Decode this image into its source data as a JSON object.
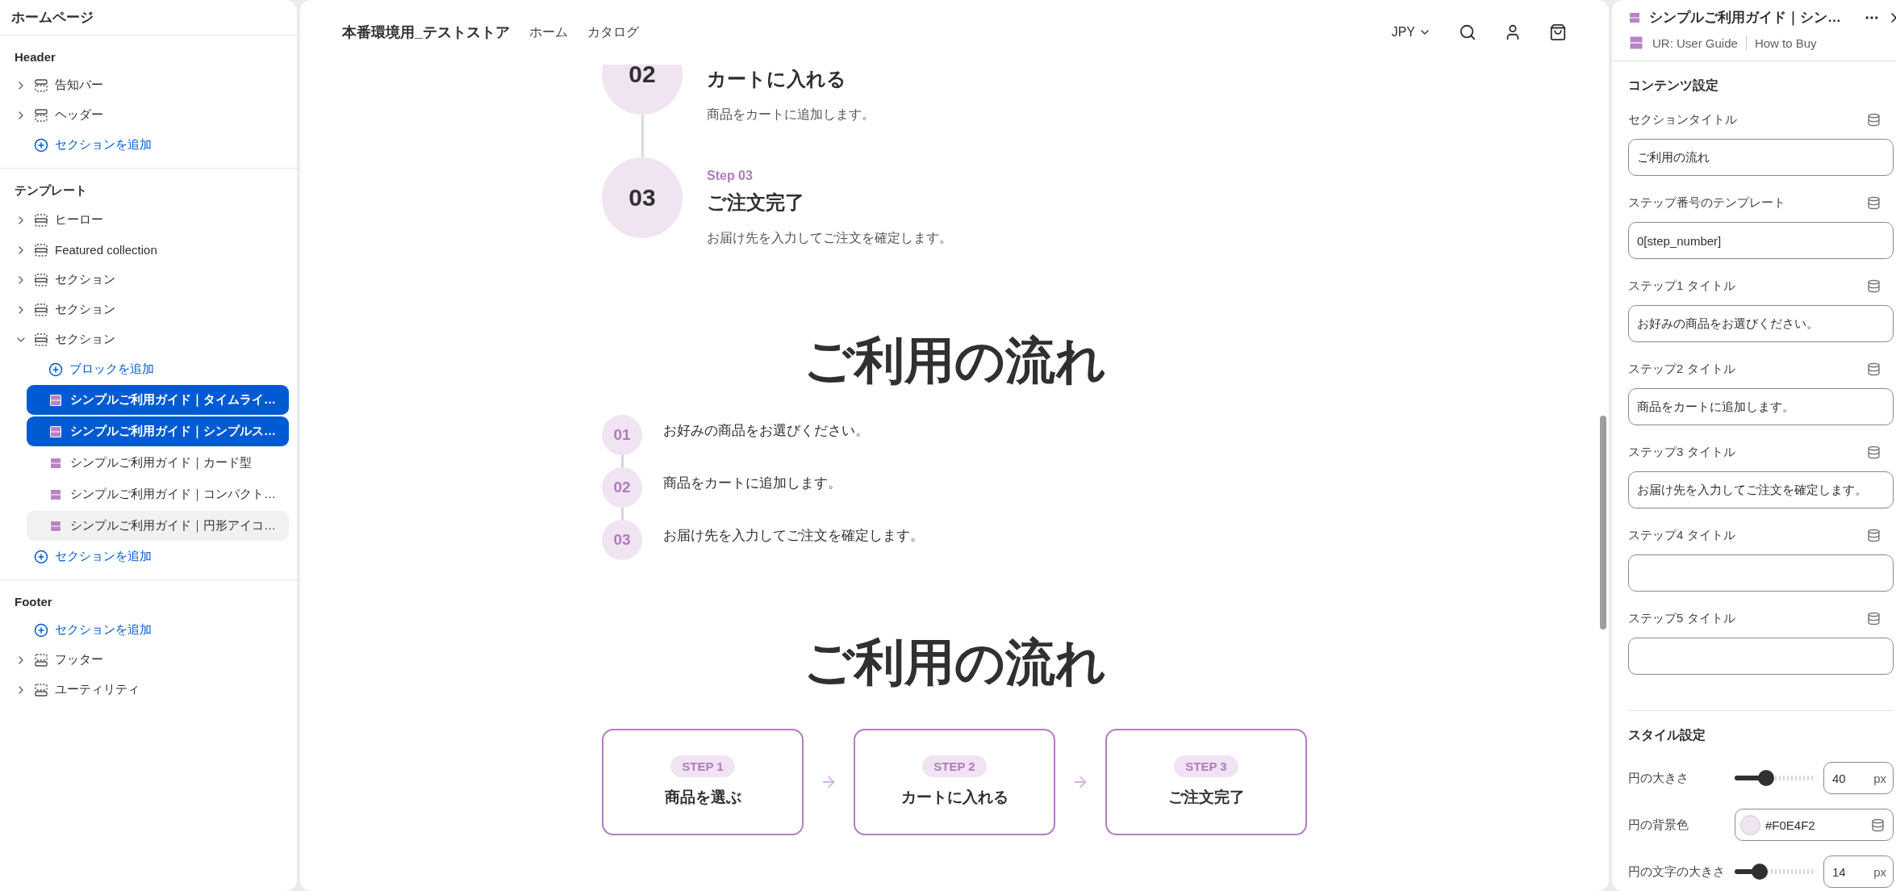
{
  "sidebar": {
    "title": "ホームページ",
    "groups": [
      {
        "kind": "header",
        "heading": "Header",
        "add_label": "セクションを追加",
        "items": [
          {
            "label": "告知バー",
            "expanded": false
          },
          {
            "label": "ヘッダー",
            "expanded": false
          }
        ]
      },
      {
        "kind": "template",
        "heading": "テンプレート",
        "add_label": "セクションを追加",
        "items": [
          {
            "label": "ヒーロー",
            "expanded": false
          },
          {
            "label": "Featured collection",
            "expanded": false
          },
          {
            "label": "セクション",
            "expanded": false
          },
          {
            "label": "セクション",
            "expanded": false
          },
          {
            "label": "セクション",
            "expanded": true,
            "add_block": "ブロックを追加",
            "children": [
              {
                "label": "シンプルご利用ガイド｜タイムライ…",
                "selected": true,
                "hovered": false
              },
              {
                "label": "シンプルご利用ガイド｜シンプルス…",
                "selected": true,
                "hovered": false
              },
              {
                "label": "シンプルご利用ガイド｜カード型",
                "selected": false,
                "hovered": false
              },
              {
                "label": "シンプルご利用ガイド｜コンパクト…",
                "selected": false,
                "hovered": false
              },
              {
                "label": "シンプルご利用ガイド｜円形アイコ…",
                "selected": false,
                "hovered": true
              }
            ]
          }
        ]
      },
      {
        "kind": "footer",
        "heading": "Footer",
        "add_label": "セクションを追加",
        "items": [
          {
            "label": "フッター",
            "expanded": false
          },
          {
            "label": "ユーティリティ",
            "expanded": false
          }
        ]
      }
    ]
  },
  "preview": {
    "store_name": "本番環境用_テストストア",
    "nav": [
      "ホーム",
      "カタログ"
    ],
    "currency": "JPY",
    "timeline": {
      "steps": [
        {
          "number": "02",
          "title": "カートに入れる",
          "description": "商品をカートに追加します。"
        },
        {
          "label": "Step 03",
          "number": "03",
          "title": "ご注文完了",
          "description": "お届け先を入力してご注文を確定します。"
        }
      ]
    },
    "compact": {
      "heading": "ご利用の流れ",
      "steps": [
        {
          "number": "01",
          "text": "お好みの商品をお選びください。"
        },
        {
          "number": "02",
          "text": "商品をカートに追加します。"
        },
        {
          "number": "03",
          "text": "お届け先を入力してご注文を確定します。"
        }
      ]
    },
    "cards": {
      "heading": "ご利用の流れ",
      "steps": [
        {
          "badge": "STEP 1",
          "title": "商品を選ぶ"
        },
        {
          "badge": "STEP 2",
          "title": "カートに入れる"
        },
        {
          "badge": "STEP 3",
          "title": "ご注文完了"
        }
      ]
    }
  },
  "panel": {
    "title": "シンプルご利用ガイド｜シン…",
    "breadcrumb": [
      "UR: User Guide",
      "How to Buy"
    ],
    "sections": [
      {
        "heading": "コンテンツ設定",
        "fields": [
          {
            "kind": "text",
            "label": "セクションタイトル",
            "value": "ご利用の流れ"
          },
          {
            "kind": "text",
            "label": "ステップ番号のテンプレート",
            "value": "0[step_number]"
          },
          {
            "kind": "text",
            "label": "ステップ1 タイトル",
            "value": "お好みの商品をお選びください。"
          },
          {
            "kind": "text",
            "label": "ステップ2 タイトル",
            "value": "商品をカートに追加します。"
          },
          {
            "kind": "text",
            "label": "ステップ3 タイトル",
            "value": "お届け先を入力してご注文を確定します。"
          },
          {
            "kind": "text",
            "label": "ステップ4 タイトル"
          },
          {
            "kind": "text",
            "label": "ステップ5 タイトル"
          }
        ]
      },
      {
        "heading": "スタイル設定",
        "fields": [
          {
            "kind": "slider",
            "label": "円の大きさ",
            "level": 0.39,
            "value": "40",
            "unit": "px"
          },
          {
            "kind": "color",
            "label": "円の背景色",
            "value": "#F0E4F2",
            "color": "#f0e4f2"
          },
          {
            "kind": "slider",
            "label": "円の文字の大きさ",
            "level": 0.31,
            "value": "14",
            "unit": "px"
          }
        ]
      }
    ]
  }
}
